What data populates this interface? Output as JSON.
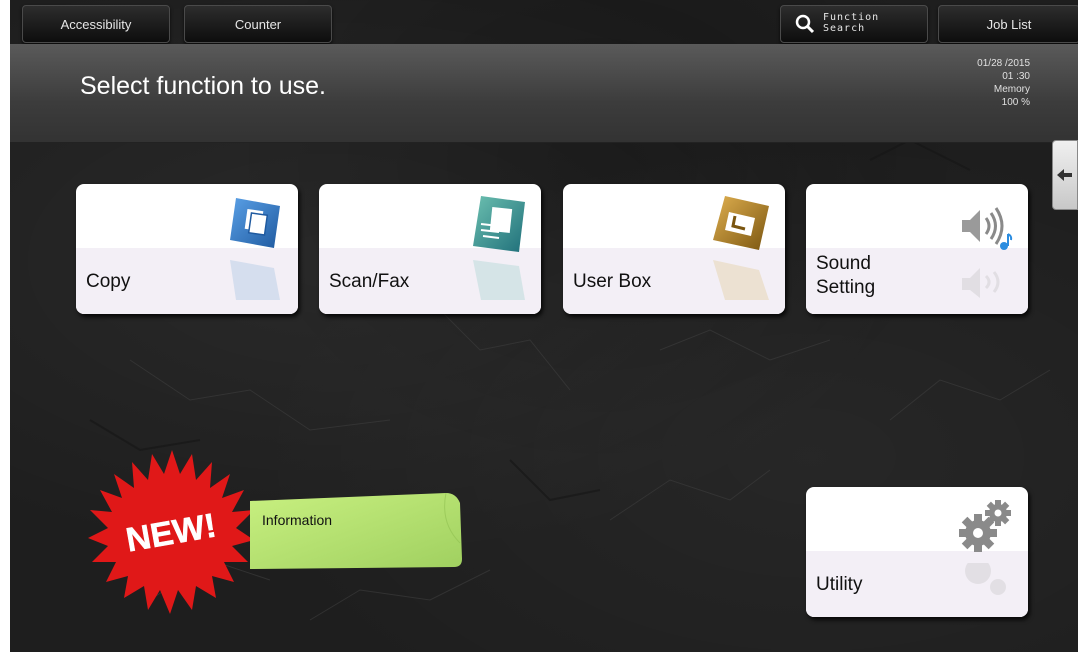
{
  "topbar": {
    "accessibility": "Accessibility",
    "counter": "Counter",
    "function_search_line1": "Function",
    "function_search_line2": "Search",
    "job_list": "Job List"
  },
  "message": "Select function to use.",
  "status": {
    "date": "01/28 /2015",
    "time": "01 :30",
    "memory_label": "Memory",
    "memory_value": "100 %"
  },
  "sidetab_icon": "arrow-left-icon",
  "tiles": {
    "copy": "Copy",
    "scan_fax": "Scan/Fax",
    "user_box": "User Box",
    "sound_line1": "Sound",
    "sound_line2": "Setting",
    "utility": "Utility"
  },
  "new_badge": "NEW!",
  "information": "Information",
  "colors": {
    "copy_icon": "#2b6fb8",
    "scan_icon": "#2a8c8c",
    "box_icon": "#b8862a",
    "info_note": "#b8e06a",
    "new_burst": "#e01818"
  }
}
